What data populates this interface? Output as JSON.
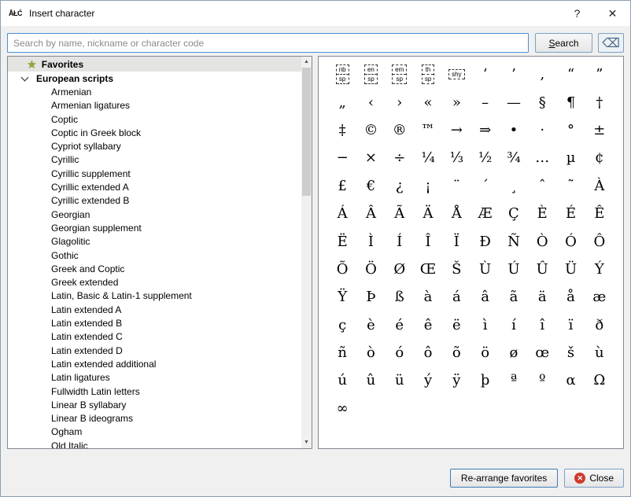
{
  "window": {
    "icon_text": "ÅŁĆ",
    "title": "Insert character",
    "help_label": "?",
    "close_label": "✕"
  },
  "search": {
    "placeholder": "Search by name, nickname or character code",
    "value": "",
    "button_accel": "S",
    "button_rest": "earch",
    "clear_icon": "⌫"
  },
  "tree": {
    "favorites_label": "Favorites",
    "group_label": "European scripts",
    "group_expanded": true,
    "children": [
      "Armenian",
      "Armenian ligatures",
      "Coptic",
      "Coptic in Greek block",
      "Cypriot syllabary",
      "Cyrillic",
      "Cyrillic supplement",
      "Cyrillic extended A",
      "Cyrillic extended B",
      "Georgian",
      "Georgian supplement",
      "Glagolitic",
      "Gothic",
      "Greek and Coptic",
      "Greek extended",
      "Latin, Basic & Latin-1 supplement",
      "Latin extended A",
      "Latin extended B",
      "Latin extended C",
      "Latin extended D",
      "Latin extended additional",
      "Latin ligatures",
      "Fullwidth Latin letters",
      "Linear B syllabary",
      "Linear B ideograms",
      "Ogham",
      "Old Italic"
    ]
  },
  "scrollbar": {
    "up_icon": "▲",
    "down_icon": "▼"
  },
  "grid": {
    "space_boxes": [
      [
        "nb",
        "sp"
      ],
      [
        "en",
        "sp"
      ],
      [
        "em",
        "sp"
      ],
      [
        "th",
        "sp"
      ],
      [
        "shy"
      ]
    ],
    "characters": [
      "‘",
      "’",
      "‚",
      "“",
      "”",
      "„",
      "‹",
      "›",
      "«",
      "»",
      "–",
      "—",
      "§",
      "¶",
      "†",
      "‡",
      "©",
      "®",
      "™",
      "→",
      "⇒",
      "•",
      "·",
      "°",
      "±",
      "−",
      "×",
      "÷",
      "¼",
      "⅓",
      "½",
      "¾",
      "…",
      "µ",
      "¢",
      "£",
      "€",
      "¿",
      "¡",
      "¨",
      "´",
      "¸",
      "ˆ",
      "˜",
      "À",
      "Á",
      "Â",
      "Ã",
      "Ä",
      "Å",
      "Æ",
      "Ç",
      "È",
      "É",
      "Ê",
      "Ë",
      "Ì",
      "Í",
      "Î",
      "Ï",
      "Ð",
      "Ñ",
      "Ò",
      "Ó",
      "Ô",
      "Õ",
      "Ö",
      "Ø",
      "Œ",
      "Š",
      "Ù",
      "Ú",
      "Û",
      "Ü",
      "Ý",
      "Ÿ",
      "Þ",
      "ß",
      "à",
      "á",
      "â",
      "ã",
      "ä",
      "å",
      "æ",
      "ç",
      "è",
      "é",
      "ê",
      "ë",
      "ì",
      "í",
      "î",
      "ï",
      "ð",
      "ñ",
      "ò",
      "ó",
      "ô",
      "õ",
      "ö",
      "ø",
      "œ",
      "š",
      "ù",
      "ú",
      "û",
      "ü",
      "ý",
      "ÿ",
      "þ",
      "ª",
      "º",
      "α",
      "Ω",
      "∞"
    ]
  },
  "footer": {
    "rearrange_label": "Re-arrange favorites",
    "close_label": "Close",
    "close_icon": "✕"
  },
  "colors": {
    "focus_border": "#4a90d9",
    "close_icon_bg": "#cf3a2c",
    "favorites_star": "#9aa437"
  }
}
